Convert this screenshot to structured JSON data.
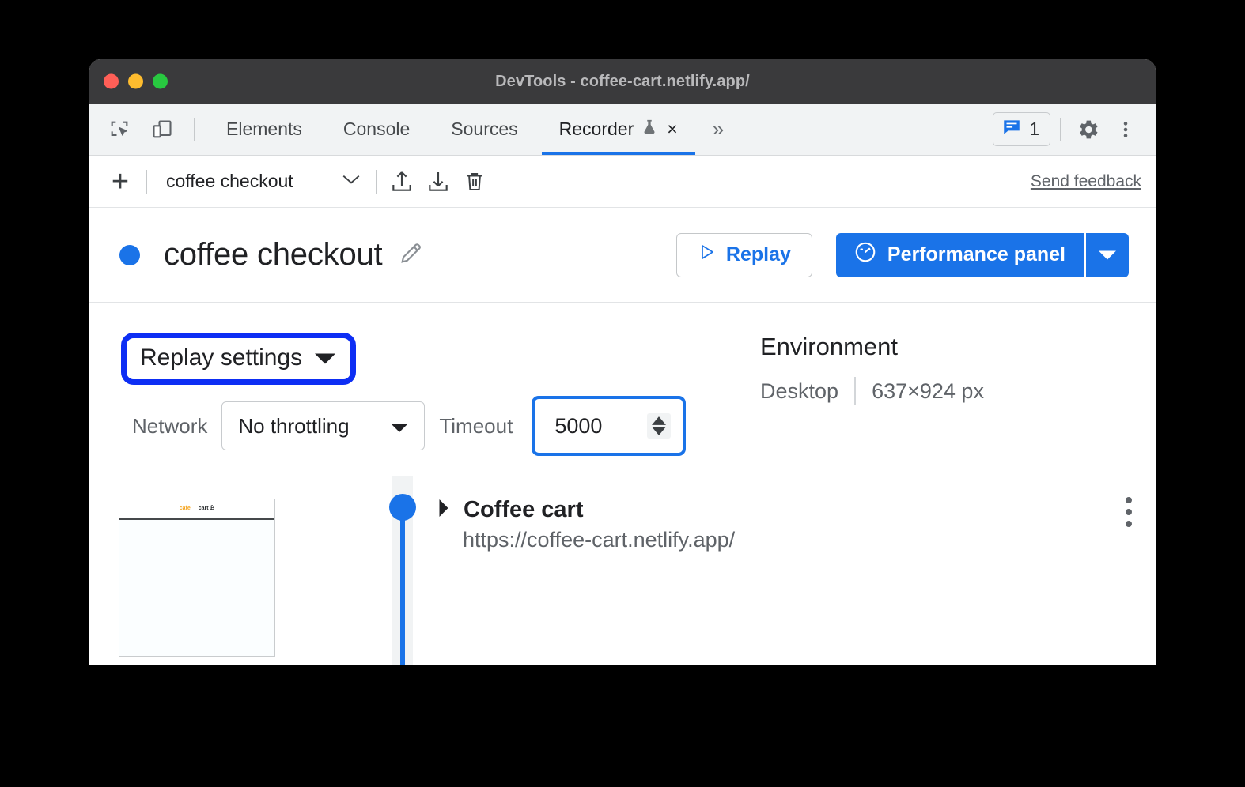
{
  "window": {
    "title": "DevTools - coffee-cart.netlify.app/"
  },
  "tabbar": {
    "inspect_icon": "inspect-element-icon",
    "device_icon": "device-toolbar-icon",
    "tabs": [
      {
        "label": "Elements",
        "active": false
      },
      {
        "label": "Console",
        "active": false
      },
      {
        "label": "Sources",
        "active": false
      },
      {
        "label": "Recorder",
        "active": true,
        "experimental": true,
        "close": "×"
      }
    ],
    "overflow": "»",
    "message_count": "1",
    "settings_icon": "gear-icon",
    "more_icon": "more-vertical-icon"
  },
  "recorder_toolbar": {
    "add_label": "+",
    "recording_name": "coffee checkout",
    "chevron": "⌄",
    "export_icon": "export-icon",
    "import_icon": "import-icon",
    "delete_icon": "trash-icon",
    "feedback_label": "Send feedback"
  },
  "header": {
    "status_dot_color": "#1a73e8",
    "title": "coffee checkout",
    "edit_icon": "pencil-icon",
    "replay_label": "Replay",
    "replay_icon": "play-icon",
    "performance_label": "Performance panel",
    "performance_icon": "speedometer-icon",
    "performance_caret": "▼"
  },
  "settings": {
    "replay_settings_label": "Replay settings",
    "replay_settings_caret": "▼",
    "highlight_color": "#0d2ef4",
    "network_label": "Network",
    "network_value": "No throttling",
    "network_caret": "▼",
    "timeout_label": "Timeout",
    "timeout_value": "5000",
    "timeout_highlight_color": "#1a73e8",
    "environment_title": "Environment",
    "environment_device": "Desktop",
    "environment_size": "637×924 px"
  },
  "steps": [
    {
      "title": "Coffee cart",
      "url": "https://coffee-cart.netlify.app/",
      "expand_icon": "triangle-right-icon",
      "menu_icon": "more-vertical-icon",
      "thumbnail": {
        "brand_text": "cafe",
        "label_text": "cart ₿"
      }
    }
  ]
}
